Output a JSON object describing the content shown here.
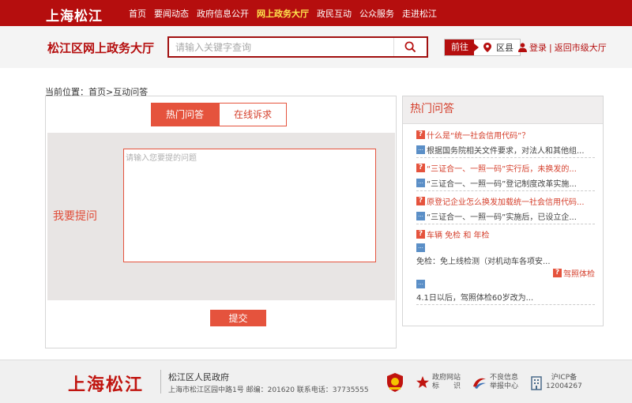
{
  "top_nav": {
    "logo": "上海松江",
    "items": [
      {
        "label": "首页",
        "active": false
      },
      {
        "label": "要闻动态",
        "active": false
      },
      {
        "label": "政府信息公开",
        "active": false
      },
      {
        "label": "网上政务大厅",
        "active": true
      },
      {
        "label": "政民互动",
        "active": false
      },
      {
        "label": "公众服务",
        "active": false
      },
      {
        "label": "走进松江",
        "active": false
      }
    ]
  },
  "header": {
    "title": "松江区网上政务大厅",
    "search_placeholder": "请输入关键字查询",
    "goto_label": "前往",
    "goto_location": "区县",
    "login_label": "登录",
    "separator": "|",
    "back_label": "返回市级大厅"
  },
  "breadcrumb": "当前位置：首页>互动问答",
  "main": {
    "tabs": [
      "热门问答",
      "在线诉求"
    ],
    "active_tab": 0,
    "ask_label": "我要提问",
    "textarea_placeholder": "请输入您要提的问题",
    "submit_label": "提交"
  },
  "hot_qa": {
    "title": "热门问答",
    "q_badge": "?",
    "a_badge": "...",
    "items": [
      {
        "question": "什么是“统一社会信用代码”？",
        "answer": "根据国务院相关文件要求，对法人和其他组..."
      },
      {
        "question": "“三证合一、一照一码”实行后，未换发的...",
        "answer": "“三证合一、一照一码”登记制度改革实施..."
      },
      {
        "question": "原登记企业怎么换发加载统一社会信用代码...",
        "answer": "“三证合一、一照一码”实施后，已设立企..."
      }
    ],
    "last_item": {
      "question": "车辆 免检 和 年检",
      "answer": "免检：免上线检测（对机动车各项安...",
      "sub_question": "驾照体检",
      "sub_answer": "4.1日以后，驾照体检60岁改为..."
    }
  },
  "footer": {
    "logo": "上海松江",
    "org": "松江区人民政府",
    "address": "上海市松江区园中路1号 邮编：201620 联系电话：37735555",
    "icons": [
      {
        "name": "party-gov-badge",
        "label": ""
      },
      {
        "name": "gov-site-identifier",
        "label": "政府网站\n标　　识"
      },
      {
        "name": "bad-info-report",
        "label": "不良信息\n举报中心"
      },
      {
        "name": "icp-record",
        "label": "沪ICP备\n12004267"
      }
    ]
  },
  "colors": {
    "brand_red": "#b50e0e",
    "accent_red": "#e5533d",
    "answer_blue": "#5b8fc7",
    "nav_highlight": "#ffe44d"
  }
}
